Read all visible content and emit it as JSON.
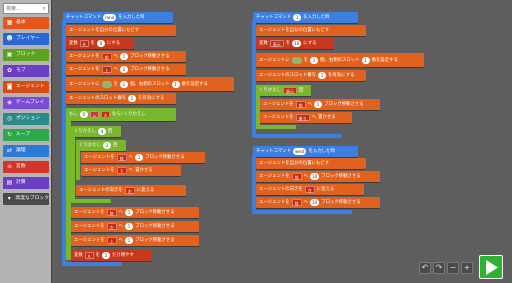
{
  "sidebar": {
    "search_placeholder": "検索...",
    "categories": [
      {
        "label": "基本",
        "color": "#e8551c",
        "icon": "grid-icon"
      },
      {
        "label": "プレイヤー",
        "color": "#2b66d6",
        "icon": "person-icon"
      },
      {
        "label": "ブロック",
        "color": "#5aa31f",
        "icon": "cube-icon"
      },
      {
        "label": "モブ",
        "color": "#6a3fc4",
        "icon": "sheep-icon"
      },
      {
        "label": "エージェント",
        "color": "#d64b12",
        "icon": "agent-icon"
      },
      {
        "label": "ゲームプレイ",
        "color": "#7a4cd6",
        "icon": "gamepad-icon"
      },
      {
        "label": "ポジション",
        "color": "#2a8a8a",
        "icon": "position-icon"
      },
      {
        "label": "ループ",
        "color": "#2aa84a",
        "icon": "loop-icon"
      },
      {
        "label": "論理",
        "color": "#2b7bd6",
        "icon": "logic-icon"
      },
      {
        "label": "変数",
        "color": "#d6342a",
        "icon": "variable-icon"
      },
      {
        "label": "計算",
        "color": "#6a3fc4",
        "icon": "math-icon"
      },
      {
        "label": "高度なブロック",
        "color": "#4a4a4a",
        "icon": "chevron-down-icon"
      }
    ]
  },
  "script1": {
    "hat": "チャットコマンド",
    "hat_val": "rana",
    "hat_suffix": "を入力した時",
    "lines": [
      {
        "t": "エージェントを自分の位置にもどす"
      },
      {
        "a": "変数",
        "b": "A",
        "c": "を",
        "d": "0",
        "e": "にする"
      },
      {
        "a": "エージェントを",
        "b": "前",
        "c": "へ",
        "d": "1",
        "e": "ブロック移動させる"
      },
      {
        "a": "エージェントを",
        "b": "上",
        "c": "へ",
        "d": "2",
        "e": "ブロック移動させる"
      },
      {
        "a": "エージェントに",
        "c": "を",
        "d": "1",
        "e": "個、右側のスロット",
        "f": "1",
        "g": "番を設定する"
      },
      {
        "a": "エージェントのスロット番号",
        "d": "1",
        "e": "を有効にする"
      },
      {
        "a": "もし",
        "b": "A",
        "c": "=",
        "d": "0",
        "e": "なら/ くりかえし"
      },
      {
        "a": "くりかえし",
        "d": "4",
        "e": "回"
      },
      {
        "a": "くりかえし",
        "d": "2",
        "e": "回"
      },
      {
        "a": "エージェントを",
        "b": "前",
        "c": "へ",
        "d": "1",
        "e": "ブロック移動させる"
      },
      {
        "a": "エージェントを",
        "b": "下",
        "c": "へ",
        "e": "置かせる"
      },
      {
        "a": "エージェントの向きを",
        "b": "右",
        "e": "に変える"
      },
      {
        "a": "エージェントを",
        "b": "前",
        "c": "へ",
        "d": "1",
        "e": "ブロック移動させる"
      },
      {
        "a": "エージェントを",
        "b": "左",
        "c": "へ",
        "d": "1",
        "e": "ブロック移動させる"
      },
      {
        "a": "エージェントを",
        "b": "上",
        "c": "へ",
        "d": "1",
        "e": "ブロック移動させる"
      },
      {
        "a": "変数",
        "b": "A",
        "c": "を",
        "d": "2",
        "e": "だけ増やす"
      }
    ]
  },
  "script2": {
    "hat": "チャットコマンド",
    "hat_val": "1",
    "hat_suffix": "を入力した時",
    "lines": [
      {
        "t": "エージェントを自分の位置にもどす"
      },
      {
        "a": "変数",
        "b": "表示",
        "c": "を",
        "d": "10",
        "e": "にする"
      },
      {
        "a": "エージェントに",
        "c": "を",
        "d": "1",
        "e": "個、右側のスロット",
        "f": "1",
        "g": "番を設定する"
      },
      {
        "a": "エージェントのスロット番号",
        "d": "1",
        "e": "を有効にする"
      },
      {
        "a": "くりかえし",
        "b": "表示",
        "e": "回"
      },
      {
        "a": "エージェントを",
        "b": "前",
        "c": "へ",
        "d": "1",
        "e": "ブロック移動させる"
      },
      {
        "a": "エージェントを",
        "b": "後ろ",
        "c": "へ",
        "e": "置かせる"
      }
    ]
  },
  "script3": {
    "hat": "チャットコマンド",
    "hat_val": "west",
    "hat_suffix": "を入力した時",
    "lines": [
      {
        "t": "エージェントを自分の位置にもどす"
      },
      {
        "a": "エージェントを",
        "b": "前",
        "c": "へ",
        "d": "10",
        "e": "ブロック移動させる"
      },
      {
        "a": "エージェントの向きを",
        "b": "左",
        "e": "に変える"
      },
      {
        "a": "エージェントを",
        "b": "前",
        "c": "へ",
        "d": "10",
        "e": "ブロック移動させる"
      }
    ]
  },
  "controls": {
    "undo": "↶",
    "redo": "↷",
    "zoom_out": "−",
    "zoom_in": "+"
  }
}
